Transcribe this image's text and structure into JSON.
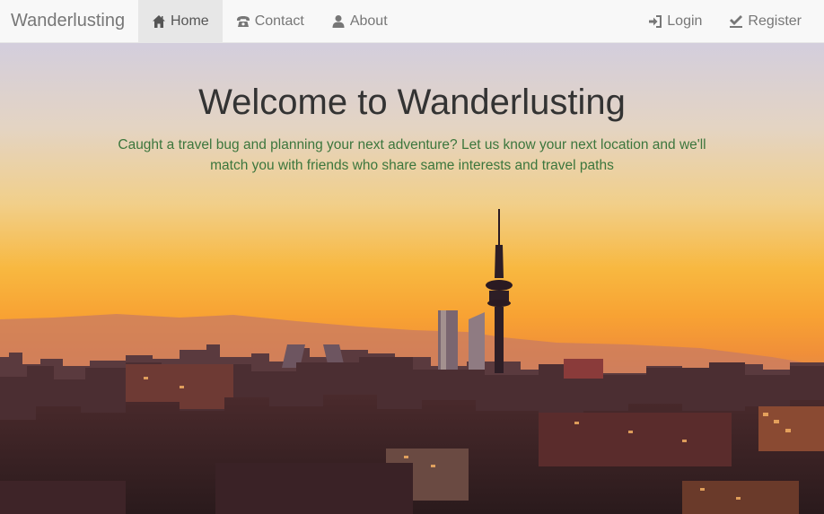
{
  "navbar": {
    "brand": "Wanderlusting",
    "left_items": [
      {
        "label": "Home",
        "icon": "home-icon"
      },
      {
        "label": "Contact",
        "icon": "phone-icon"
      },
      {
        "label": "About",
        "icon": "user-icon"
      }
    ],
    "right_items": [
      {
        "label": "Login",
        "icon": "login-icon"
      },
      {
        "label": "Register",
        "icon": "checkmark-icon"
      }
    ]
  },
  "hero": {
    "title": "Welcome to Wanderlusting",
    "subtitle": "Caught a travel bug and planning your next adventure? Let us know your next location and we'll match you with friends who share same interests and travel paths"
  },
  "colors": {
    "navbar_bg": "#f8f8f8",
    "active_tab_bg": "#e7e7e7",
    "title_color": "#333333",
    "subtitle_color": "#3c763d"
  }
}
